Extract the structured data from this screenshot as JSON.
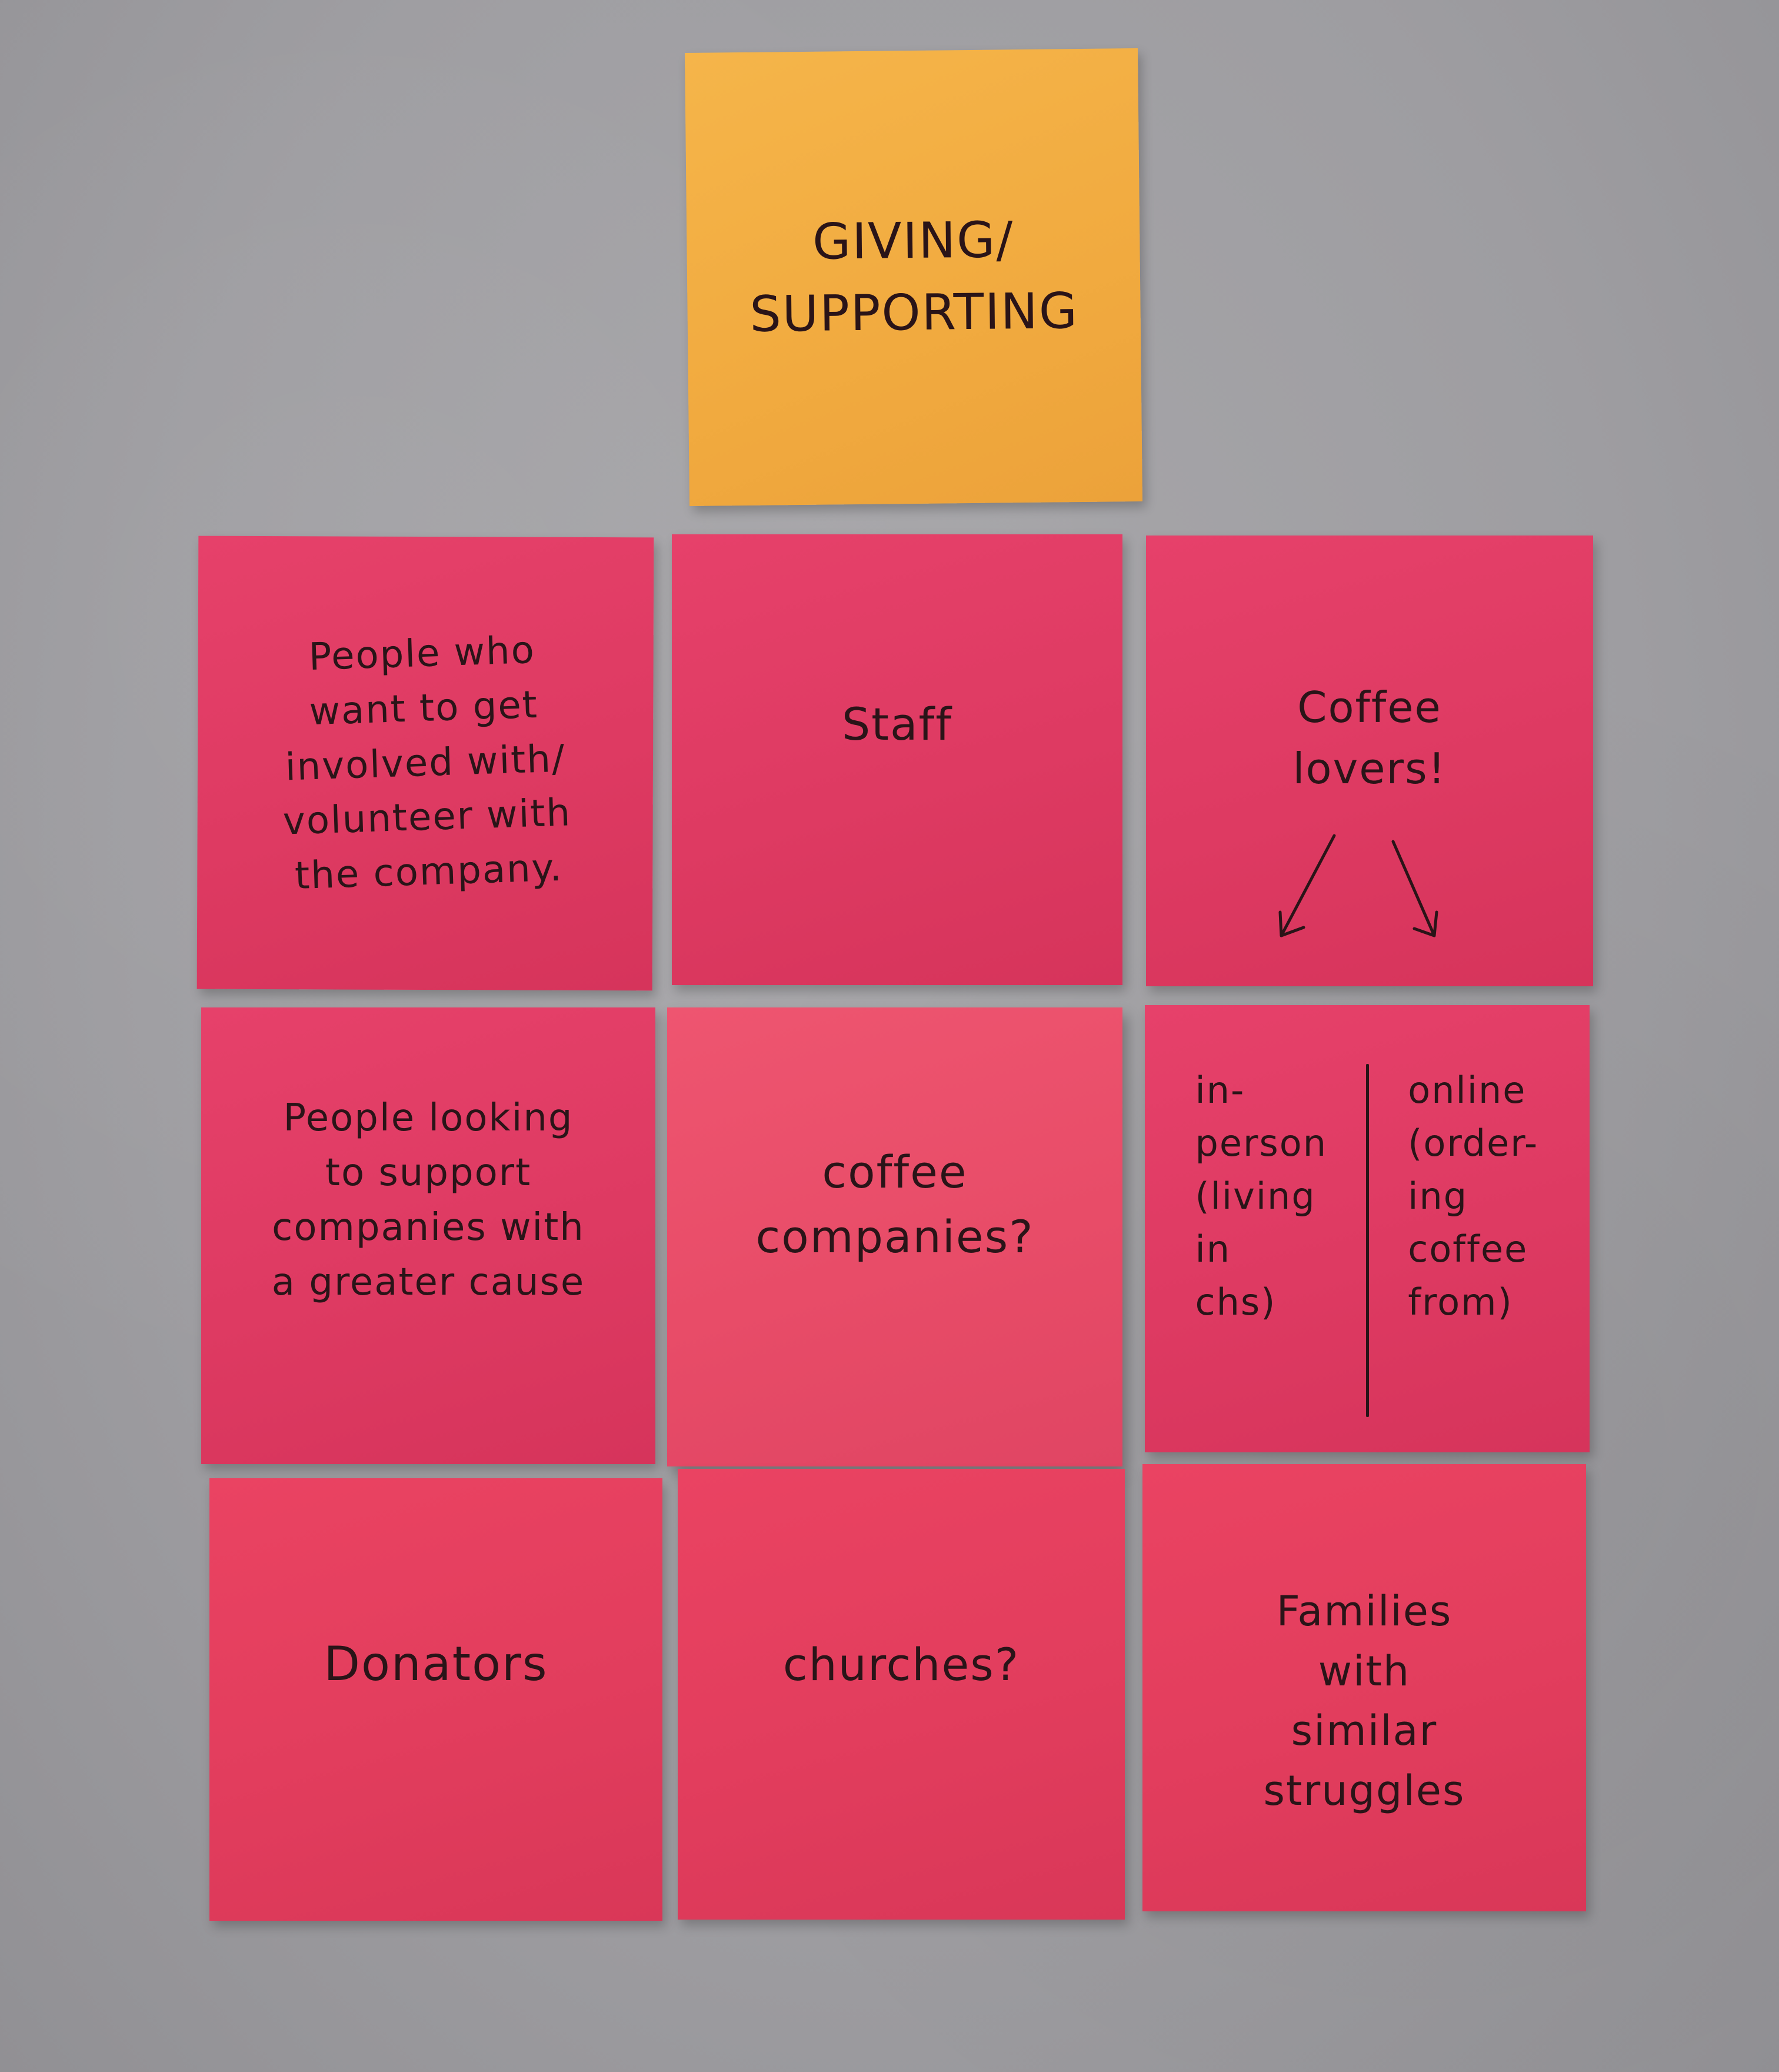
{
  "notes": {
    "header": "GIVING/\nSUPPORTING",
    "volunteers": "People who\nwant to get\ninvolved with/\nvolunteer with\nthe company.",
    "staff": "Staff",
    "coffee_lovers": "Coffee\nlovers!",
    "greater_cause": "People looking\nto support\ncompanies with\na greater cause",
    "coffee_companies": "coffee\ncompanies?",
    "in_person": "in-\nperson\n(living\nin\nchs)",
    "online": "online\n(order-\ning\ncoffee\nfrom)",
    "donators": "Donators",
    "churches": "churches?",
    "families": "Families\nwith\nsimilar\nstruggles"
  },
  "colors": {
    "wall": "#9e9da1",
    "yellow_note": "#f1aa3f",
    "pink_note": "#de3a62",
    "ink": "#2a1418"
  }
}
